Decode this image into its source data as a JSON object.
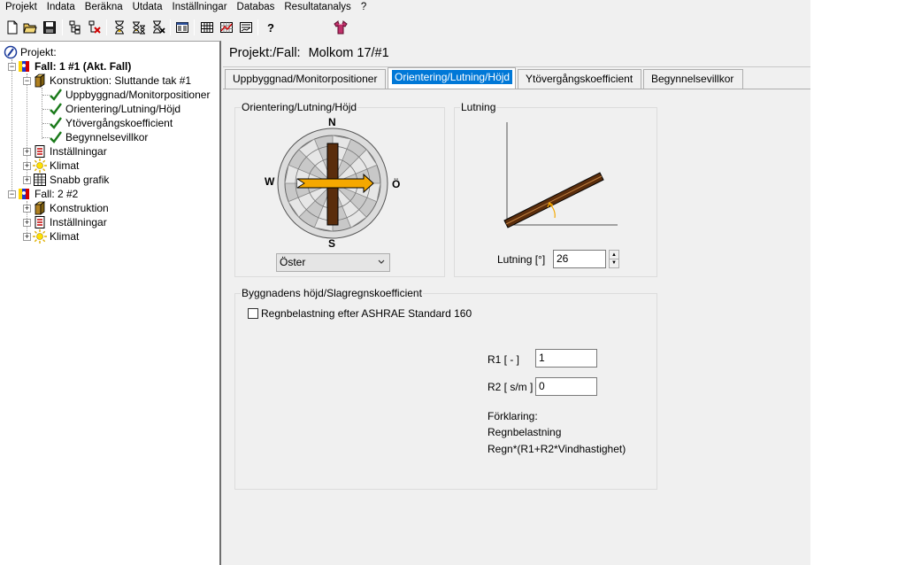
{
  "menubar": {
    "items": [
      "Projekt",
      "Indata",
      "Beräkna",
      "Utdata",
      "Inställningar",
      "Databas",
      "Resultatanalys",
      "?"
    ]
  },
  "toolbar": {
    "icons": [
      "new-file-icon",
      "open-folder-icon",
      "save-icon",
      "tree-structure-icon",
      "delete-tree-icon",
      "hourglass-icon",
      "hourglass-multiple-icon",
      "hourglass-delete-icon",
      "properties-icon",
      "layer-grid-icon",
      "chart-grid-icon",
      "diagram-icon",
      "help-icon",
      "tshirt-icon"
    ]
  },
  "tree": {
    "root_label": "Projekt:",
    "case1": {
      "label": "Fall: 1 #1 (Akt. Fall)",
      "construction": "Konstruktion: Sluttande tak #1",
      "children": [
        "Uppbyggnad/Monitorpositioner",
        "Orientering/Lutning/Höjd",
        "Ytövergångskoefficient",
        "Begynnelsevillkor"
      ],
      "settings": "Inställningar",
      "climate": "Klimat",
      "quick_graph": "Snabb grafik"
    },
    "case2": {
      "label": "Fall: 2 #2",
      "construction": "Konstruktion",
      "settings": "Inställningar",
      "climate": "Klimat"
    }
  },
  "main": {
    "title_prefix": "Projekt:/Fall:",
    "title_value": "Molkom 17/#1",
    "tabs": [
      {
        "label": "Uppbyggnad/Monitorpositioner",
        "active": false
      },
      {
        "label": "Orientering/Lutning/Höjd",
        "active": true
      },
      {
        "label": "Ytövergångskoefficient",
        "active": false
      },
      {
        "label": "Begynnelsevillkor",
        "active": false
      }
    ],
    "orientation": {
      "group_title": "Orientering/Lutning/Höjd",
      "north": "N",
      "south": "S",
      "west": "W",
      "east": "Ö",
      "direction_value": "Öster"
    },
    "slope": {
      "group_title": "Lutning",
      "label": "Lutning [°]",
      "value": "26"
    },
    "building": {
      "group_title": "Byggnadens höjd/Slagregnskoefficient",
      "checkbox_label": "Regnbelastning efter ASHRAE Standard 160",
      "checkbox_checked": false,
      "r1_label": "R1 [ - ]",
      "r1_value": "1",
      "r2_label": "R2 [ s/m ]",
      "r2_value": "0",
      "explanation_label": "Förklaring:",
      "explanation_line1": "Regnbelastning",
      "explanation_line2": "Regn*(R1+R2*Vindhastighet)"
    }
  },
  "colors": {
    "tab_active_bg": "#0078d7",
    "beam_brown": "#5a2d0c",
    "arrow_orange": "#f5a800",
    "check_green": "#1a7a1a"
  }
}
